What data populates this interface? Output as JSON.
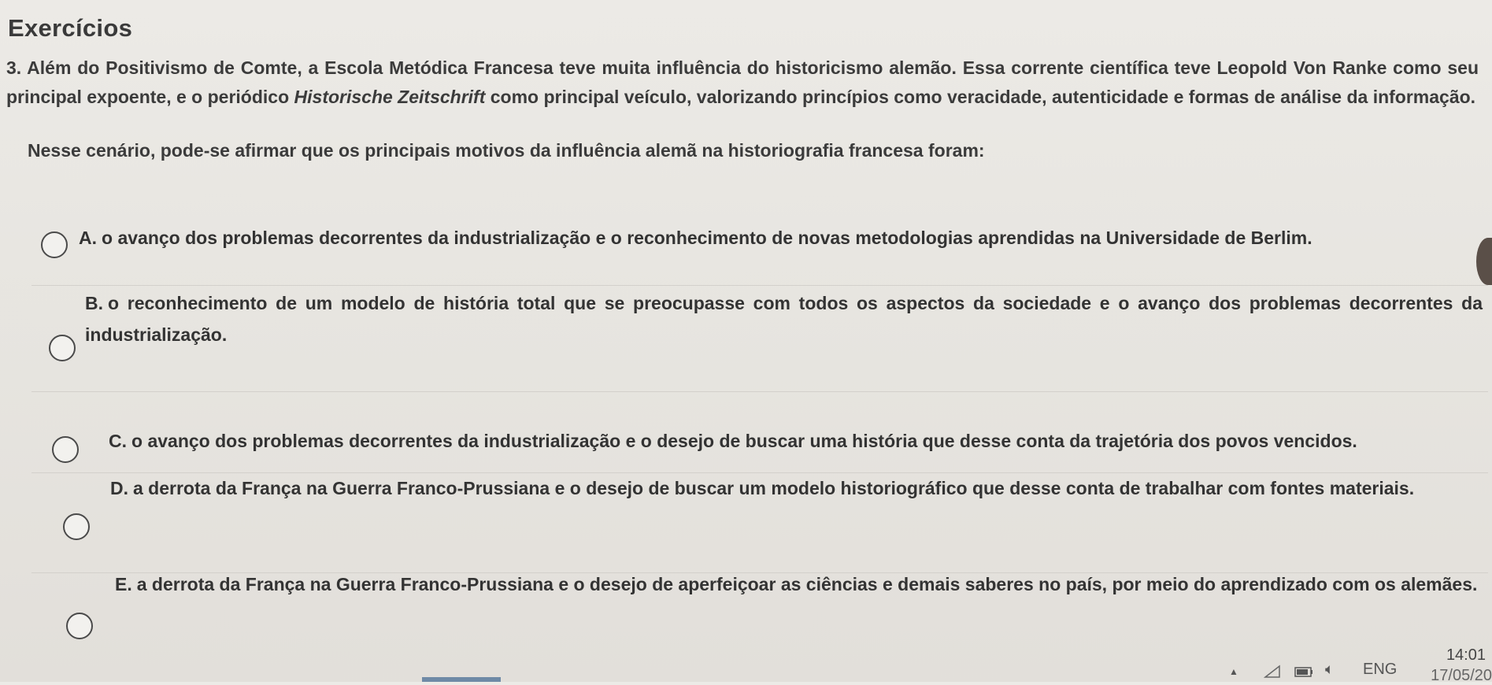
{
  "heading": "Exercícios",
  "question": {
    "part1": "3. Além do Positivismo de Comte, a Escola Metódica Francesa teve muita influência do historicismo alemão. Essa corrente científica teve Leopold Von Ranke como seu principal expoente, e o periódico ",
    "journal": "Historische Zeitschrift",
    "part2": " como principal veículo, valorizando princípios como veracidade, autenticidade e formas de análise da informação.",
    "prompt": "Nesse cenário, pode-se afirmar que os principais motivos da influência alemã na historiografia francesa foram:"
  },
  "options": [
    {
      "letter": "A.",
      "text": "o avanço dos problemas decorrentes da industrialização e o reconhecimento de novas metodologias aprendidas na Universidade de Berlim."
    },
    {
      "letter": "B.",
      "text": "o reconhecimento de um modelo de história total que se preocupasse com todos os aspectos da sociedade e o avanço dos problemas decorrentes da industrialização."
    },
    {
      "letter": "C.",
      "text": "o avanço dos problemas decorrentes da industrialização e o desejo de buscar uma história que desse conta da trajetória dos povos vencidos."
    },
    {
      "letter": "D.",
      "text": "a derrota da França na Guerra Franco-Prussiana e o desejo de buscar um modelo historiográfico que desse conta de trabalhar com fontes materiais."
    },
    {
      "letter": "E.",
      "text": "a derrota da França na Guerra Franco-Prussiana e o desejo de aperfeiçoar as ciências e demais saberes no país, por meio do aprendizado com os alemães."
    }
  ],
  "tray": {
    "language": "ENG",
    "time": "14:01",
    "date": "17/05/20",
    "icons": [
      "chevron-up-icon",
      "wifi-icon",
      "battery-icon",
      "speaker-icon"
    ]
  }
}
